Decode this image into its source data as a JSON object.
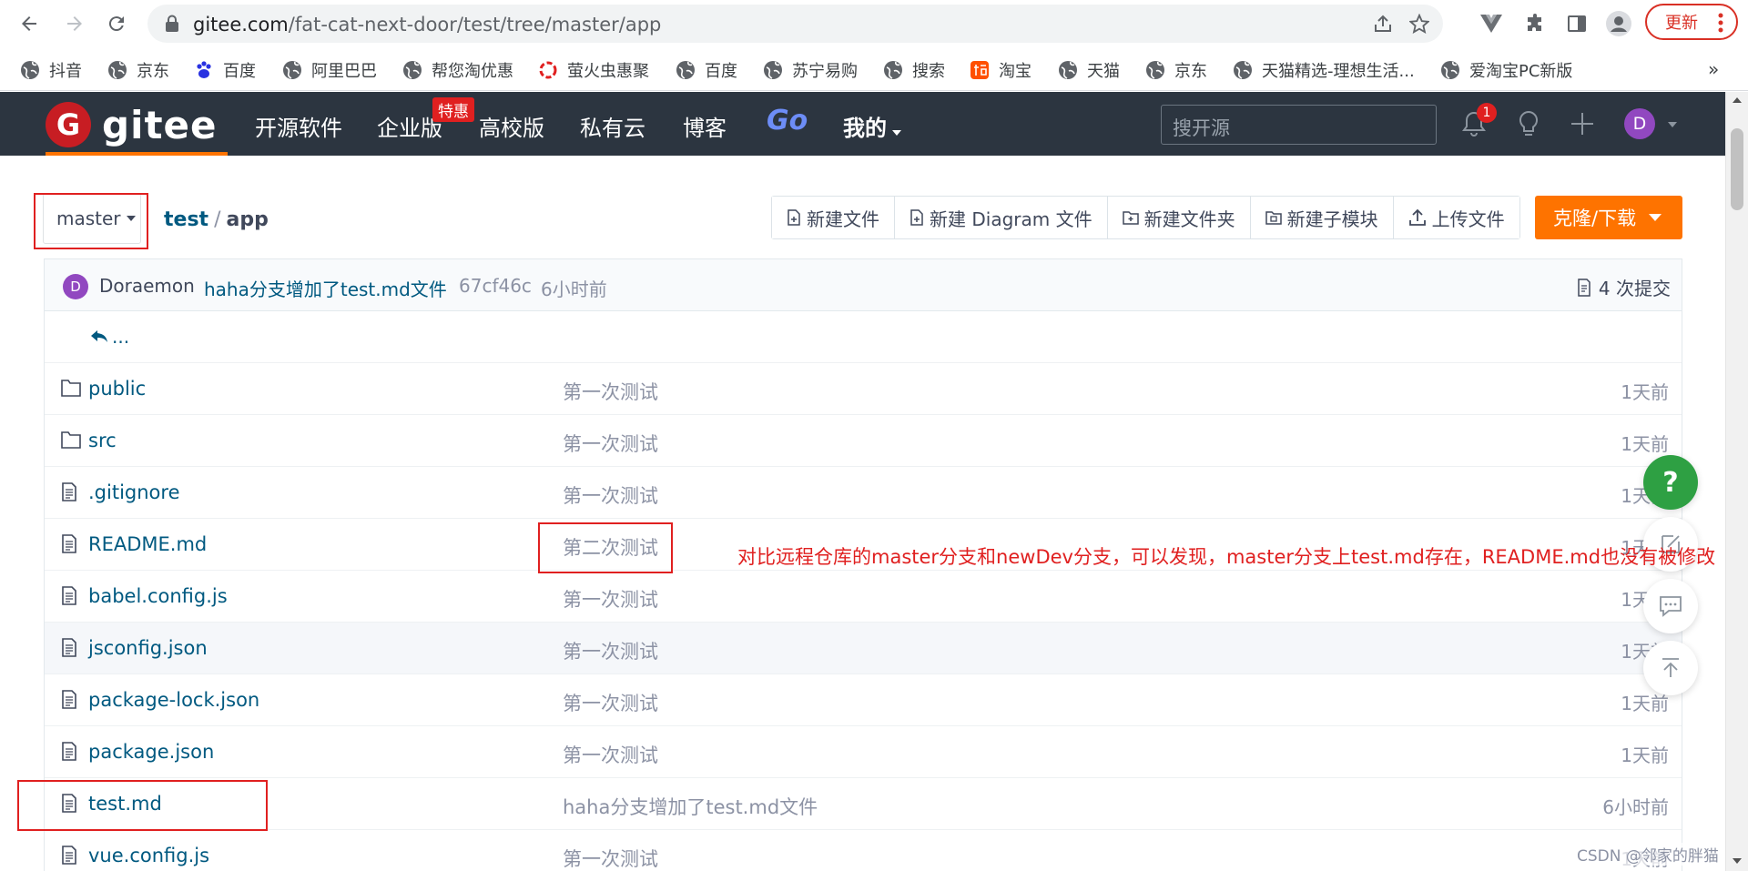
{
  "browser": {
    "url_host": "gitee.com",
    "url_path": "/fat-cat-next-door/test/tree/master/app",
    "update_label": "更新",
    "bookmarks": [
      "抖音",
      "京东",
      "百度",
      "阿里巴巴",
      "帮您淘优惠",
      "萤火虫惠聚",
      "百度",
      "苏宁易购",
      "搜索",
      "淘宝",
      "天猫",
      "京东",
      "天猫精选-理想生活...",
      "爱淘宝PC新版"
    ],
    "bookmarks_more": "»"
  },
  "header": {
    "logo_text": "gitee",
    "logo_mark": "G",
    "nav": [
      "开源软件",
      "企业版",
      "高校版",
      "私有云",
      "博客"
    ],
    "hot_badge": "特惠",
    "go_label": "Go",
    "mine_label": "我的",
    "search_placeholder": "搜开源",
    "notif_count": "1",
    "avatar_letter": "D"
  },
  "repo": {
    "branch": "master",
    "breadcrumb_repo": "test",
    "breadcrumb_sep": "/",
    "breadcrumb_dir": "app",
    "toolbar": [
      "新建文件",
      "新建 Diagram 文件",
      "新建文件夹",
      "新建子模块",
      "上传文件"
    ],
    "clone_label": "克隆/下载"
  },
  "commit": {
    "avatar_letter": "D",
    "author": "Doraemon",
    "message": "haha分支增加了test.md文件",
    "hash": "67cf46c",
    "time": "6小时前",
    "count_label": "4 次提交"
  },
  "back_label": "...",
  "files": [
    {
      "name": "public",
      "type": "folder",
      "message": "第一次测试",
      "time": "1天前"
    },
    {
      "name": "src",
      "type": "folder",
      "message": "第一次测试",
      "time": "1天前"
    },
    {
      "name": ".gitignore",
      "type": "file",
      "message": "第一次测试",
      "time": "1天前"
    },
    {
      "name": "README.md",
      "type": "file",
      "message": "第二次测试",
      "time": "1天前"
    },
    {
      "name": "babel.config.js",
      "type": "file",
      "message": "第一次测试",
      "time": "1天前"
    },
    {
      "name": "jsconfig.json",
      "type": "file",
      "message": "第一次测试",
      "time": "1天前"
    },
    {
      "name": "package-lock.json",
      "type": "file",
      "message": "第一次测试",
      "time": "1天前"
    },
    {
      "name": "package.json",
      "type": "file",
      "message": "第一次测试",
      "time": "1天前"
    },
    {
      "name": "test.md",
      "type": "file",
      "message": "haha分支增加了test.md文件",
      "time": "6小时前"
    },
    {
      "name": "vue.config.js",
      "type": "file",
      "message": "第一次测试",
      "time": "1天前"
    }
  ],
  "help_label": "?",
  "annotation": "对比远程仓库的master分支和newDev分支，可以发现，master分支上test.md存在，README.md也没有被修改",
  "watermark": "CSDN @邻家的胖猫"
}
